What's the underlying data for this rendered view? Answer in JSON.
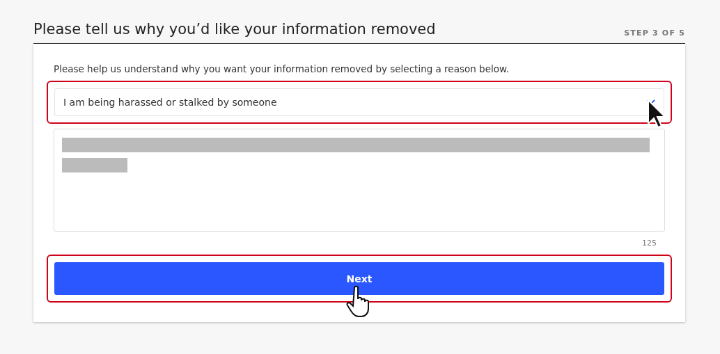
{
  "header": {
    "title": "Please tell us why you’d like your information removed",
    "step": "STEP 3 OF 5"
  },
  "form": {
    "intro": "Please help us understand why you want your information removed by selecting a reason below.",
    "reason_select": {
      "value": "I am being harassed or stalked by someone",
      "highlighted": true
    },
    "details": {
      "counter": "125"
    },
    "next_button": {
      "label": "Next",
      "highlighted": true
    }
  }
}
